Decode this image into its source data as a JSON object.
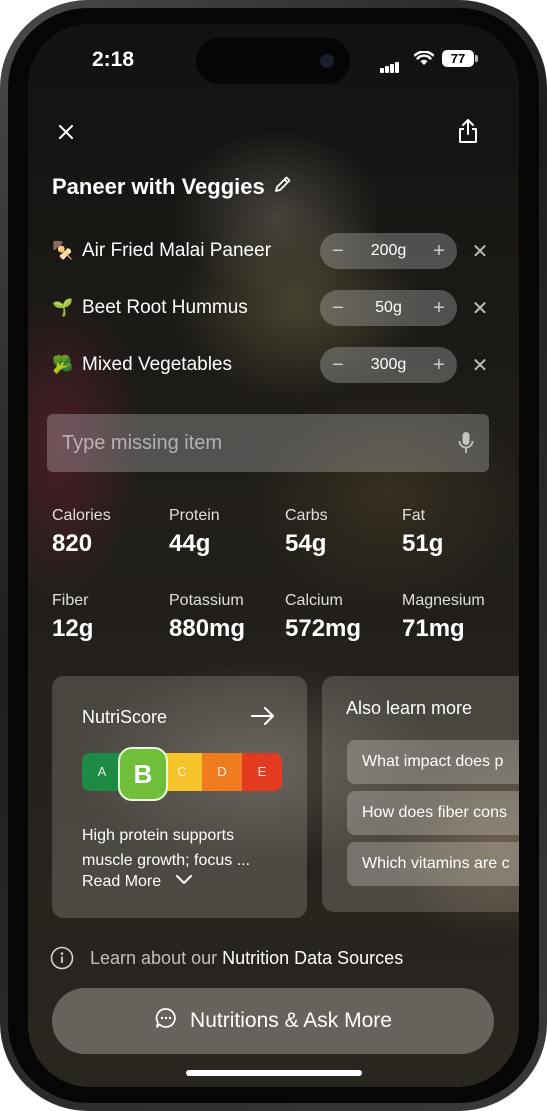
{
  "status_bar": {
    "time": "2:18",
    "battery": "77"
  },
  "header": {
    "close_icon": "close-icon",
    "share_icon": "share-icon"
  },
  "meal": {
    "title": "Paneer with Veggies",
    "edit_icon": "pencil-icon"
  },
  "items": [
    {
      "emoji": "🍢",
      "name": "Air Fried Malai Paneer",
      "quantity": "200g"
    },
    {
      "emoji": "🌱",
      "name": "Beet Root Hummus",
      "quantity": "50g"
    },
    {
      "emoji": "🥦",
      "name": "Mixed Vegetables",
      "quantity": "300g"
    }
  ],
  "stepper": {
    "minus": "−",
    "plus": "+",
    "remove": "✕"
  },
  "search": {
    "placeholder": "Type missing item",
    "mic_icon": "microphone-icon"
  },
  "nutrients": [
    {
      "label": "Calories",
      "value": "820"
    },
    {
      "label": "Protein",
      "value": "44g"
    },
    {
      "label": "Carbs",
      "value": "54g"
    },
    {
      "label": "Fat",
      "value": "51g"
    },
    {
      "label": "Fiber",
      "value": "12g"
    },
    {
      "label": "Potassium",
      "value": "880mg"
    },
    {
      "label": "Calcium",
      "value": "572mg"
    },
    {
      "label": "Magnesium",
      "value": "71mg"
    }
  ],
  "nutriscore": {
    "title": "NutriScore",
    "grades": [
      "A",
      "B",
      "C",
      "D",
      "E"
    ],
    "active_grade": "B",
    "grade_colors": [
      "#1d8b43",
      "#6fbf3a",
      "#f6c42a",
      "#ef7d1f",
      "#e33b1f"
    ],
    "description_line1": "High protein supports",
    "description_line2": "muscle growth; focus ...",
    "read_more": "Read More"
  },
  "learn_more": {
    "title": "Also learn more",
    "questions": [
      "What impact does p",
      "How does fiber cons",
      "Which vitamins are c"
    ]
  },
  "sources": {
    "prefix": "Learn about our ",
    "link": "Nutrition Data Sources"
  },
  "footer": {
    "button_label": "Nutritions & Ask More"
  }
}
